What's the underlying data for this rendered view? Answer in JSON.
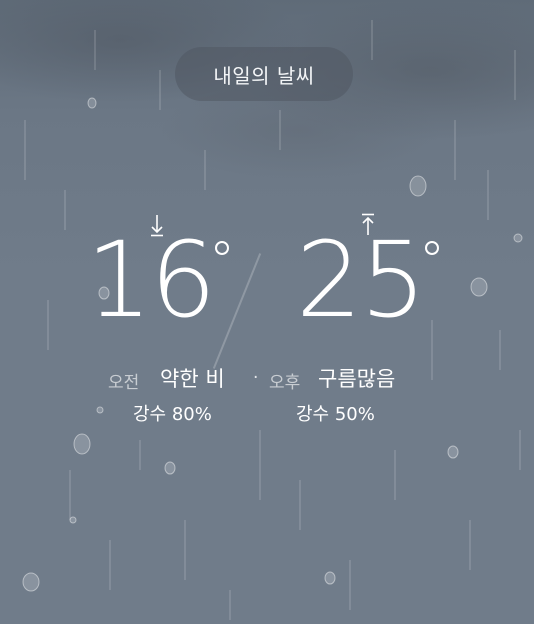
{
  "title": "내일의 날씨",
  "temperature": {
    "low": "16",
    "high": "25",
    "low_arrow": "down-arrow-icon",
    "high_arrow": "up-arrow-icon"
  },
  "morning": {
    "label": "오전",
    "condition": "약한 비",
    "precipitation": "강수 80%"
  },
  "separator": "·",
  "afternoon": {
    "label": "오후",
    "condition": "구름많음",
    "precipitation": "강수 50%"
  },
  "colors": {
    "background": "#707c8a",
    "pill": "#505862",
    "text": "#ffffff"
  }
}
